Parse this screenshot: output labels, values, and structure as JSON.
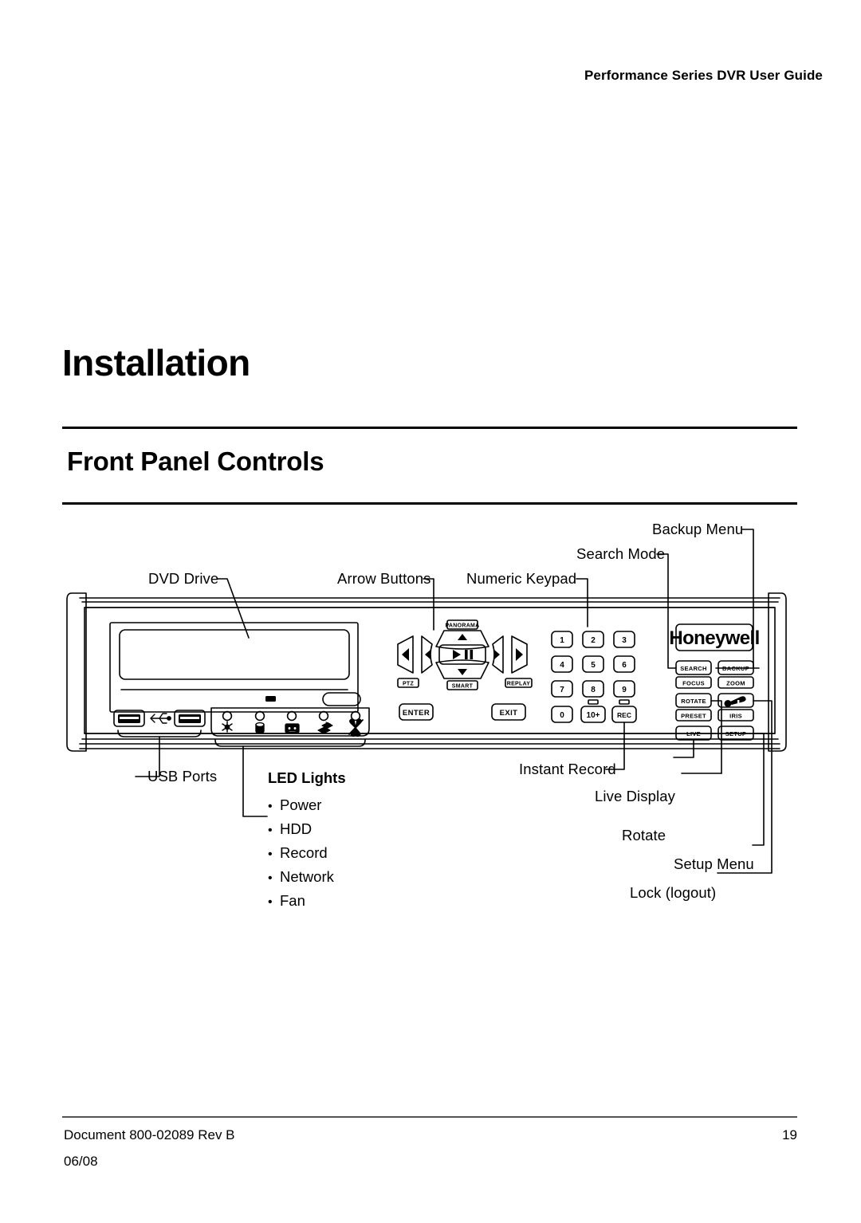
{
  "header": {
    "running_title": "Performance Series DVR User Guide"
  },
  "chapter": {
    "title": "Installation"
  },
  "section": {
    "title": "Front Panel Controls"
  },
  "figure": {
    "callouts_top": [
      {
        "id": "dvd-drive",
        "label": "DVD Drive"
      },
      {
        "id": "arrow-buttons",
        "label": "Arrow Buttons"
      },
      {
        "id": "numeric-keypad",
        "label": "Numeric Keypad"
      },
      {
        "id": "search-mode",
        "label": "Search Mode"
      },
      {
        "id": "backup-menu",
        "label": "Backup Menu"
      }
    ],
    "callouts_bottom": [
      {
        "id": "usb-ports",
        "label": "USB Ports"
      },
      {
        "id": "instant-record",
        "label": "Instant Record"
      },
      {
        "id": "live-display",
        "label": "Live Display"
      },
      {
        "id": "rotate",
        "label": "Rotate"
      },
      {
        "id": "setup-menu",
        "label": "Setup Menu"
      },
      {
        "id": "lock-logout",
        "label": "Lock (logout)"
      }
    ],
    "led_lights": {
      "heading": "LED Lights",
      "items": [
        "Power",
        "HDD",
        "Record",
        "Network",
        "Fan"
      ]
    },
    "panel": {
      "brand": "Honeywell",
      "dpad": {
        "up_label": "PANORAMA",
        "down_label": "SMART",
        "left_label": "PTZ",
        "right_label": "REPLAY",
        "center_icon": "play-pause-icon",
        "up_icon": "triangle-up-icon",
        "down_icon": "triangle-down-icon",
        "left_icon": "triangle-left-icon",
        "right_icon": "triangle-right-icon",
        "outer_left_icon": "double-triangle-left-icon",
        "outer_right_icon": "double-triangle-right-icon"
      },
      "enter_label": "ENTER",
      "exit_label": "EXIT",
      "keypad": [
        "1",
        "2",
        "3",
        "4",
        "5",
        "6",
        "7",
        "8",
        "9",
        "0",
        "10+",
        "REC"
      ],
      "function_keys": [
        {
          "top": "SEARCH",
          "bottom": "FOCUS"
        },
        {
          "top": "BACKUP",
          "bottom": "ZOOM"
        },
        {
          "top": "ROTATE",
          "bottom": "PRESET"
        },
        {
          "top": "key-icon",
          "bottom": "IRIS"
        },
        {
          "top": "LIVE",
          "bottom": ""
        },
        {
          "top": "SETUP",
          "bottom": ""
        }
      ],
      "led_icons": [
        "power-led-icon",
        "hdd-led-icon",
        "record-led-icon",
        "network-led-icon",
        "fan-led-icon"
      ],
      "usb_icon": "usb-icon"
    }
  },
  "footer": {
    "document": "Document 800-02089  Rev B",
    "date": "06/08",
    "page_number": "19"
  },
  "colors": {
    "ink": "#000000",
    "rule": "#555555"
  }
}
